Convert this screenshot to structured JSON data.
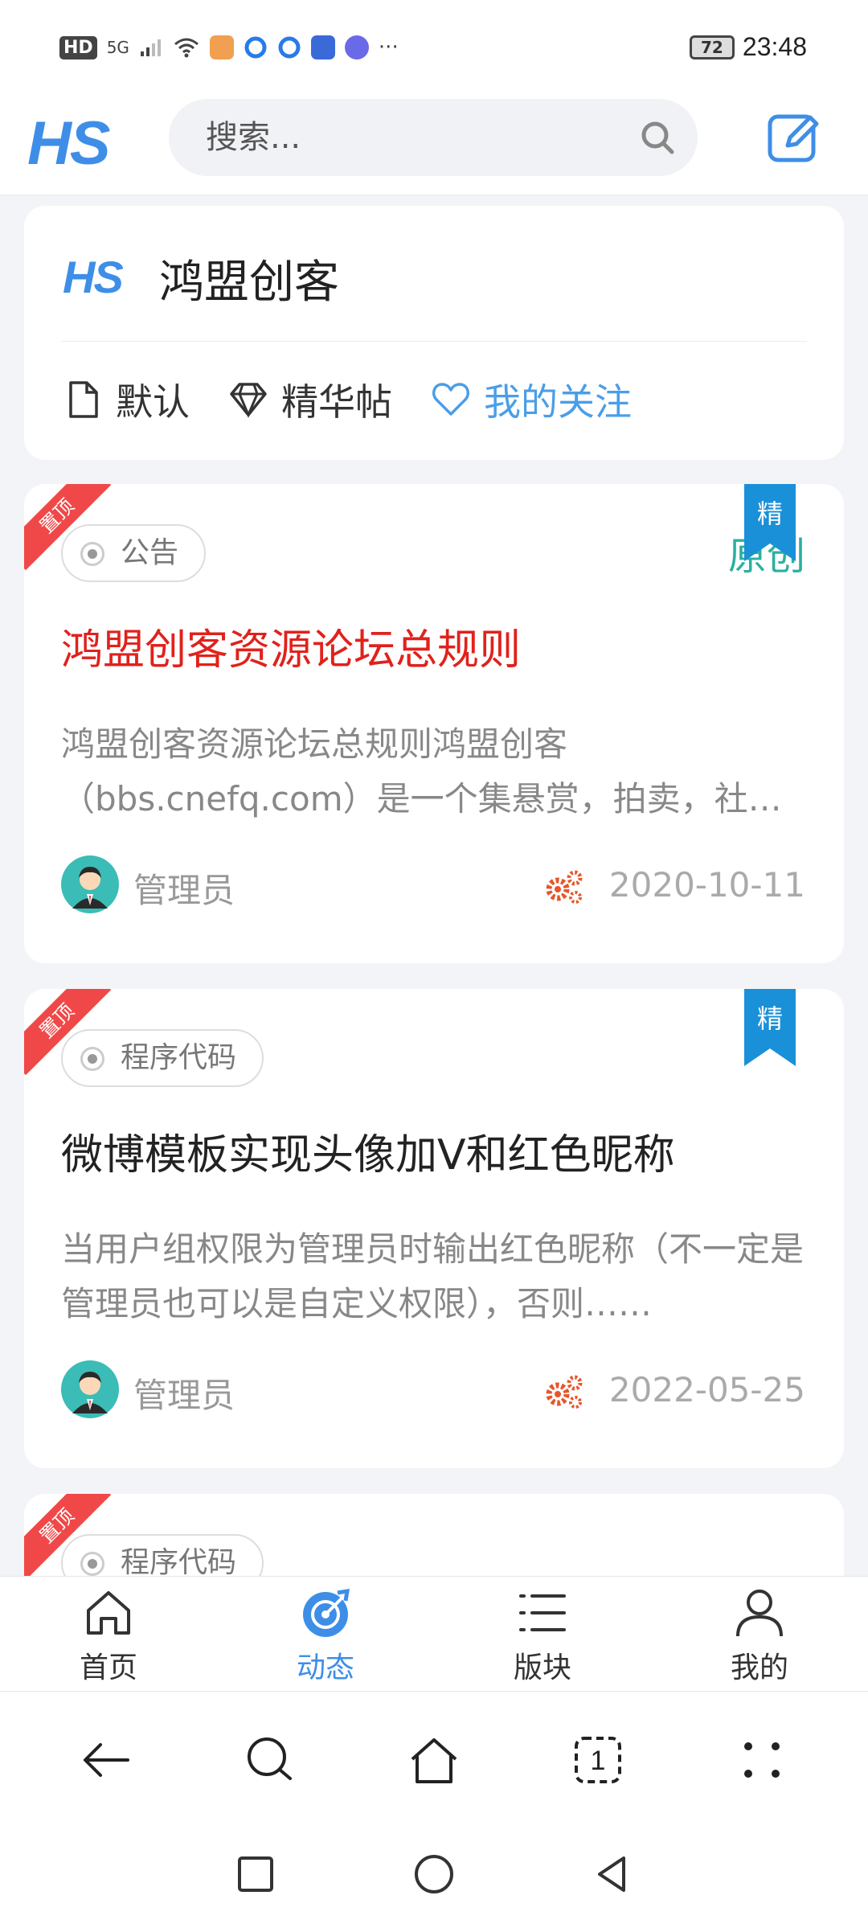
{
  "status_bar": {
    "hd": "HD",
    "signal": "5G",
    "battery": "72",
    "time": "23:48",
    "more": "···"
  },
  "header": {
    "logo": "HS",
    "search_placeholder": "搜索..."
  },
  "forum": {
    "logo": "HS",
    "name": "鸿盟创客",
    "tabs": [
      {
        "label": "默认",
        "icon": "document-icon",
        "active": false
      },
      {
        "label": "精华帖",
        "icon": "diamond-icon",
        "active": false
      },
      {
        "label": "我的关注",
        "icon": "heart-icon",
        "active": true
      }
    ]
  },
  "posts": [
    {
      "ribbon": "置顶",
      "pin": "精",
      "badge": "原创",
      "category": "公告",
      "title": "鸿盟创客资源论坛总规则",
      "title_color": "#e0221c",
      "excerpt": "鸿盟创客资源论坛总规则鸿盟创客（bbs.cnefq.com）是一个集悬赏，拍卖，社交，付费……",
      "author": "管理员",
      "date": "2020-10-11"
    },
    {
      "ribbon": "置顶",
      "pin": "精",
      "category": "程序代码",
      "title": "微博模板实现头像加V和红色昵称",
      "excerpt": "当用户组权限为管理员时输出红色昵称（不一定是管理员也可以是自定义权限），否则……",
      "author": "管理员",
      "date": "2022-05-25"
    },
    {
      "ribbon": "置顶",
      "category": "程序代码"
    }
  ],
  "bottom_nav": [
    {
      "label": "首页",
      "icon": "home-icon",
      "active": false
    },
    {
      "label": "动态",
      "icon": "dynamic-icon",
      "active": true
    },
    {
      "label": "版块",
      "icon": "list-icon",
      "active": false
    },
    {
      "label": "我的",
      "icon": "user-icon",
      "active": false
    }
  ],
  "browser_bar": {
    "tab_count": "1"
  },
  "colors": {
    "accent": "#3e8ee8",
    "pin": "#1a90d8",
    "ribbon": "#f04848",
    "original": "#2ab0a0",
    "gear": "#e8562a"
  }
}
